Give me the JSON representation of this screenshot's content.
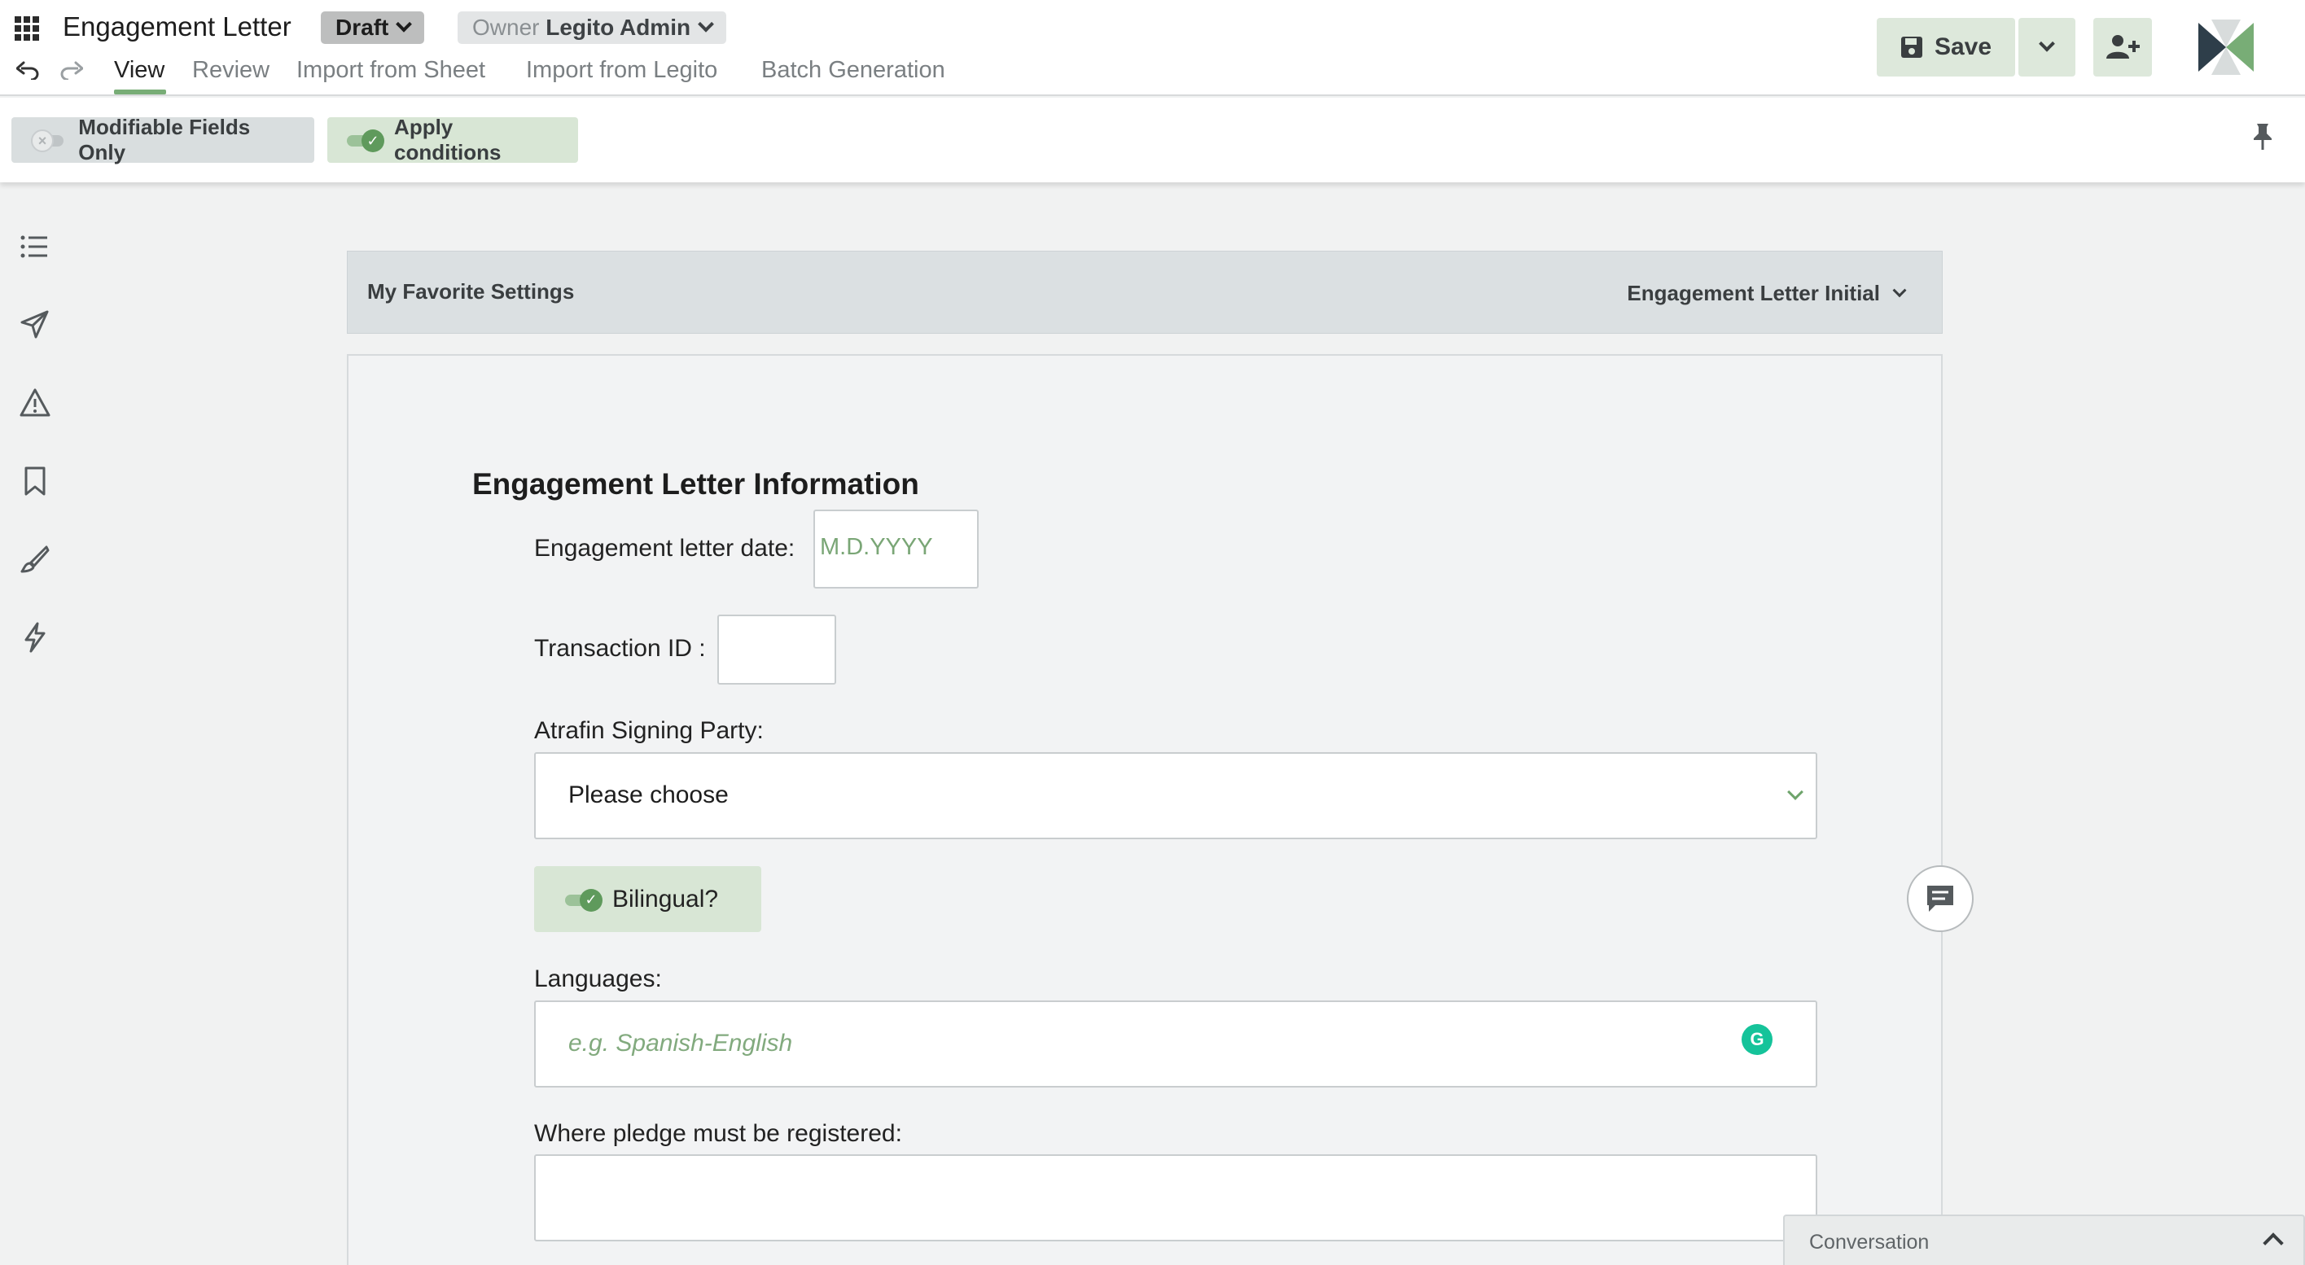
{
  "header": {
    "title": "Engagement Letter",
    "status": "Draft",
    "owner_prefix": "Owner",
    "owner_name": "Legito Admin",
    "tabs": [
      {
        "label": "View",
        "active": true
      },
      {
        "label": "Review"
      },
      {
        "label": "Import from Sheet"
      },
      {
        "label": "Import from Legito"
      },
      {
        "label": "Batch Generation"
      }
    ],
    "save_label": "Save"
  },
  "toolbar": {
    "modifiable_fields_label": "Modifiable Fields Only",
    "modifiable_fields_on": false,
    "apply_conditions_label": "Apply conditions",
    "apply_conditions_on": true
  },
  "sidebar": {
    "icons": [
      "list-icon",
      "send-icon",
      "warning-icon",
      "bookmark-icon",
      "brush-icon",
      "lightning-icon"
    ]
  },
  "favorites": {
    "label": "My Favorite Settings",
    "selected": "Engagement Letter Initial"
  },
  "form": {
    "section_title": "Engagement Letter Information",
    "date_label": "Engagement letter date:",
    "date_placeholder": "M.D.YYYY",
    "transaction_label": "Transaction ID :",
    "transaction_value": "",
    "signing_party_label": "Atrafin Signing Party:",
    "signing_party_value": "Please choose",
    "bilingual_label": "Bilingual?",
    "bilingual_on": true,
    "languages_label": "Languages:",
    "languages_placeholder": "e.g. Spanish-English",
    "pledge_label": "Where pledge must be registered:",
    "pledge_value": ""
  },
  "conversation": {
    "label": "Conversation"
  },
  "colors": {
    "accent_green": "#78ad76",
    "button_bg": "#dde8db",
    "grammarly": "#15c39a"
  }
}
